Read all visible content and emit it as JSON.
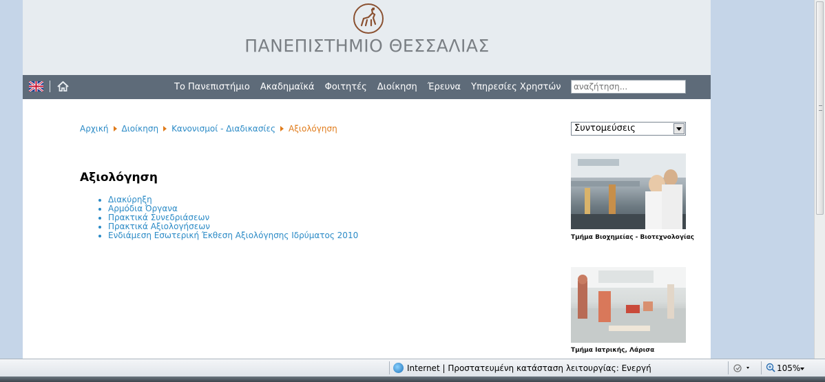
{
  "header": {
    "site_name": "ΠΑΝΕΠΙΣΤΗΜΙΟ ΘΕΣΣΑΛΙΑΣ",
    "seal_icon": "centaur-seal-icon"
  },
  "nav": {
    "lang_icon": "uk-flag-icon",
    "home_icon": "home-icon",
    "items": [
      {
        "label": "Το Πανεπιστήμιο"
      },
      {
        "label": "Ακαδημαϊκά"
      },
      {
        "label": "Φοιτητές"
      },
      {
        "label": "Διοίκηση"
      },
      {
        "label": "Έρευνα"
      },
      {
        "label": "Υπηρεσίες Χρηστών"
      }
    ],
    "search_placeholder": "αναζήτηση..."
  },
  "breadcrumb": [
    {
      "label": "Αρχική"
    },
    {
      "label": "Διοίκηση"
    },
    {
      "label": "Κανονισμοί - Διαδικασίες"
    },
    {
      "label": "Αξιολόγηση"
    }
  ],
  "main": {
    "title": "Αξιολόγηση",
    "links": [
      {
        "label": "Διακύρηξη"
      },
      {
        "label": "Αρμόδια Όργανα"
      },
      {
        "label": "Πρακτικά Συνεδριάσεων"
      },
      {
        "label": "Πρακτικά Αξιολογήσεων"
      },
      {
        "label": "Ενδιάμεση Εσωτερική Έκθεση Αξιολόγησης Ιδρύματος 2010"
      }
    ]
  },
  "sidebar": {
    "shortcuts_selected": "Συντομεύσεις",
    "promos": [
      {
        "caption": "Τμήμα Βιοχημείας - Βιοτεχνολογίας"
      },
      {
        "caption": "Τμήμα Ιατρικής, Λάρισα"
      }
    ]
  },
  "statusbar": {
    "zone_text": "Internet | Προστατευμένη κατάσταση λειτουργίας: Ενεργή",
    "zoom": "105%"
  },
  "colors": {
    "link": "#2a8ac6",
    "current_crumb": "#e07b1a",
    "navbar": "#5e6b79",
    "header_bg": "#e7ecf0"
  }
}
